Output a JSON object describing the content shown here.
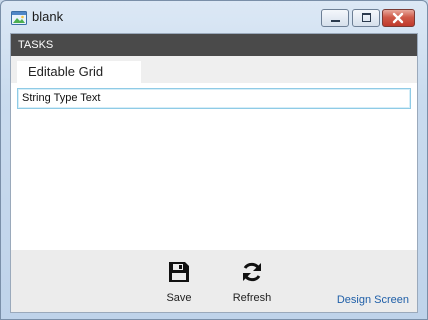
{
  "window": {
    "title": "blank",
    "icons": {
      "app": "app-window-icon",
      "minimize": "minimize-icon",
      "maximize": "maximize-icon",
      "close": "close-icon"
    }
  },
  "tasks": {
    "label": "TASKS"
  },
  "tabs": [
    {
      "label": "Editable Grid"
    }
  ],
  "grid": {
    "field_value": "String Type Text"
  },
  "footer": {
    "save_label": "Save",
    "refresh_label": "Refresh",
    "design_link": "Design Screen",
    "icons": {
      "save": "save-icon",
      "refresh": "refresh-icon"
    }
  },
  "colors": {
    "tasks_bar": "#4a4a4a",
    "input_focus_border": "#8fcbe6",
    "link": "#1f5fa8",
    "close_button": "#c0392b"
  }
}
